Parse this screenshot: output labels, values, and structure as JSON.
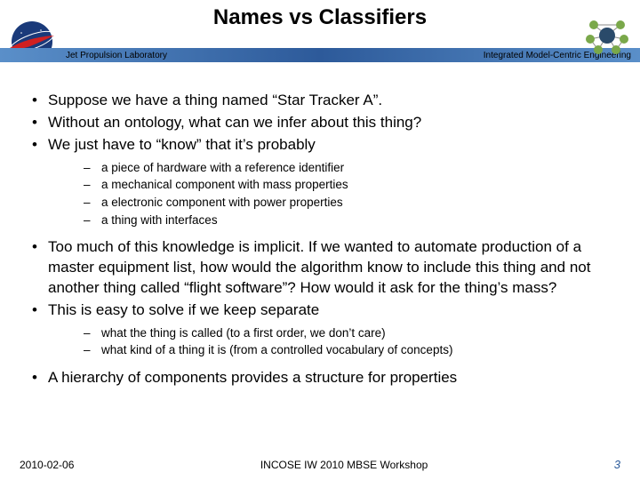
{
  "title": "Names vs Classifiers",
  "header": {
    "left_label": "Jet Propulsion Laboratory",
    "right_label": "Integrated Model-Centric Engineering"
  },
  "bullets": [
    {
      "text": "Suppose we have a thing named “Star Tracker A”."
    },
    {
      "text": "Without an ontology, what can we infer about this thing?"
    },
    {
      "text": "We just have to “know” that it’s probably",
      "sub": [
        "a piece of hardware with a reference identifier",
        "a mechanical component with mass properties",
        "a electronic component with power properties",
        "a thing with interfaces"
      ]
    },
    {
      "text": "Too much of this knowledge is implicit. If we wanted to automate production of a master equipment list, how would the algorithm know to include this thing and not another thing called “flight software”? How would it ask for the thing’s mass?"
    },
    {
      "text": "This is easy to solve if we keep separate",
      "sub": [
        "what the thing is called (to a first order, we don’t care)",
        "what kind of a thing it is (from a controlled vocabulary of concepts)"
      ]
    },
    {
      "text": "A hierarchy of components provides a structure for properties"
    }
  ],
  "footer": {
    "date": "2010-02-06",
    "center": "INCOSE IW 2010 MBSE Workshop",
    "page": "3"
  }
}
